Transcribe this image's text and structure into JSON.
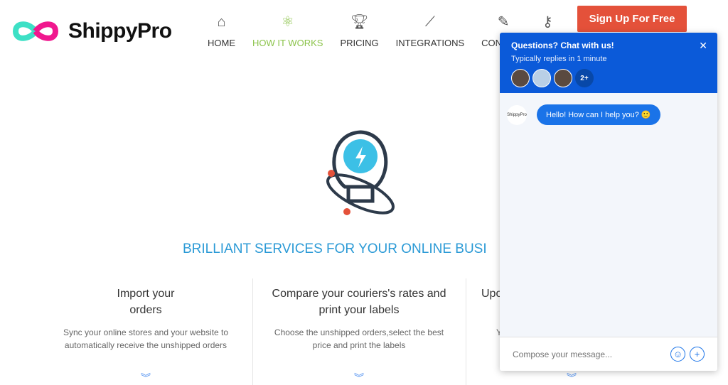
{
  "brand": {
    "name": "ShippyPro"
  },
  "nav": [
    {
      "label": "HOME",
      "icon": "home-icon"
    },
    {
      "label": "HOW IT WORKS",
      "icon": "atom-icon"
    },
    {
      "label": "PRICING",
      "icon": "trophy-icon"
    },
    {
      "label": "INTEGRATIONS",
      "icon": "chart-line-icon"
    },
    {
      "label": "CONTACT",
      "icon": "pencil-icon"
    },
    {
      "label": "",
      "icon": "key-icon"
    }
  ],
  "signup_label": "Sign Up For Free",
  "hero_title": "BRILLIANT SERVICES FOR YOUR ONLINE BUSI",
  "features": [
    {
      "title1": "Import your",
      "title2": "orders",
      "desc1": "Sync your online stores and your website to",
      "desc2": "automatically receive the unshipped orders"
    },
    {
      "title1": "Compare your couriers's rates and",
      "title2": "print your labels",
      "desc1": "Choose the unshipped orders,select the best",
      "desc2": "price and print the labels"
    },
    {
      "title1": "Upo",
      "title2": "",
      "desc1": "Y",
      "desc2": ""
    }
  ],
  "chat": {
    "title": "Questions? Chat with us!",
    "subtitle": "Typically replies in 1 minute",
    "more": "2+",
    "bot_label": "ShippyPro",
    "message": "Hello! How can I help you? 🙂",
    "placeholder": "Compose your message..."
  },
  "colors": {
    "accent": "#8bc34a",
    "signup": "#e4513a",
    "chat": "#0b5ad9",
    "title": "#2b9ad6"
  }
}
